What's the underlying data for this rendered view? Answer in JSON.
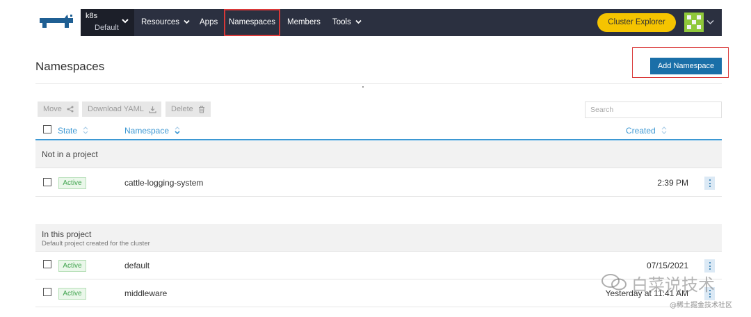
{
  "nav": {
    "cluster_name": "k8s",
    "project_name": "Default",
    "items": [
      {
        "label": "Resources"
      },
      {
        "label": "Apps"
      },
      {
        "label": "Namespaces"
      },
      {
        "label": "Members"
      },
      {
        "label": "Tools"
      }
    ],
    "explorer_button": "Cluster Explorer",
    "colors": {
      "bar": "#2b3040",
      "accent_yellow": "#f5c400",
      "highlight_red": "#d93838"
    }
  },
  "page": {
    "title": "Namespaces",
    "add_button": "Add Namespace"
  },
  "toolbar": {
    "move_label": "Move",
    "download_label": "Download YAML",
    "delete_label": "Delete",
    "search_placeholder": "Search"
  },
  "table": {
    "headers": {
      "state": "State",
      "namespace": "Namespace",
      "created": "Created"
    },
    "groups": [
      {
        "title": "Not in a project",
        "subtitle": "",
        "rows": [
          {
            "state": "Active",
            "namespace": "cattle-logging-system",
            "created": "2:39 PM"
          }
        ]
      },
      {
        "title": "In this project",
        "subtitle": "Default project created for the cluster",
        "rows": [
          {
            "state": "Active",
            "namespace": "default",
            "created": "07/15/2021"
          },
          {
            "state": "Active",
            "namespace": "middleware",
            "created": "Yesterday at 11:41 AM"
          }
        ]
      }
    ]
  },
  "watermark": {
    "main": "白菜说技术",
    "sub": "@稀土掘金技术社区"
  }
}
